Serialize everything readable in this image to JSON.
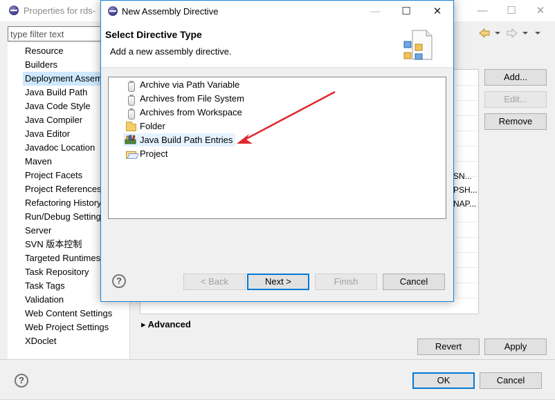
{
  "props": {
    "title": "Properties for rds-",
    "filter_placeholder": "type filter text",
    "tree_items": [
      {
        "label": "Resource"
      },
      {
        "label": "Builders"
      },
      {
        "label": "Deployment Assem"
      },
      {
        "label": "Java Build Path"
      },
      {
        "label": "Java Code Style"
      },
      {
        "label": "Java Compiler"
      },
      {
        "label": "Java Editor"
      },
      {
        "label": "Javadoc Location"
      },
      {
        "label": "Maven"
      },
      {
        "label": "Project Facets"
      },
      {
        "label": "Project References"
      },
      {
        "label": "Refactoring History"
      },
      {
        "label": "Run/Debug Setting"
      },
      {
        "label": "Server"
      },
      {
        "label": "SVN 版本控制"
      },
      {
        "label": "Targeted Runtimes"
      },
      {
        "label": "Task Repository"
      },
      {
        "label": "Task Tags"
      },
      {
        "label": "Validation"
      },
      {
        "label": "Web Content Settings"
      },
      {
        "label": "Web Project Settings"
      },
      {
        "label": "XDoclet"
      }
    ],
    "selected_tree_item": "Deployment Assem",
    "table_cells": [
      "SN...",
      "PSH...",
      "NAP..."
    ],
    "buttons": {
      "add": "Add...",
      "edit": "Edit...",
      "remove": "Remove",
      "revert": "Revert",
      "apply": "Apply",
      "ok": "OK",
      "cancel": "Cancel"
    },
    "advanced_label": "Advanced",
    "advanced_arrow": "▸"
  },
  "dialog": {
    "title": "New Assembly Directive",
    "header_title": "Select Directive Type",
    "header_desc": "Add a new assembly directive.",
    "items": [
      {
        "label": "Archive via Path Variable",
        "icon": "jar-icon"
      },
      {
        "label": "Archives from File System",
        "icon": "jar-icon"
      },
      {
        "label": "Archives from Workspace",
        "icon": "jar-icon"
      },
      {
        "label": "Folder",
        "icon": "folder-icon"
      },
      {
        "label": "Java Build Path Entries",
        "icon": "library-icon"
      },
      {
        "label": "Project",
        "icon": "project-icon"
      }
    ],
    "highlighted_item": "Java Build Path Entries",
    "buttons": {
      "back": "< Back",
      "next": "Next >",
      "finish": "Finish",
      "cancel": "Cancel"
    },
    "help_glyph": "?"
  },
  "window_controls": {
    "minimize": "—",
    "maximize": "☐",
    "close": "✕"
  },
  "colors": {
    "accent": "#0078d7",
    "selection": "#cde8ff",
    "hover": "#e5f3ff",
    "annotation_arrow": "#e0272d"
  }
}
